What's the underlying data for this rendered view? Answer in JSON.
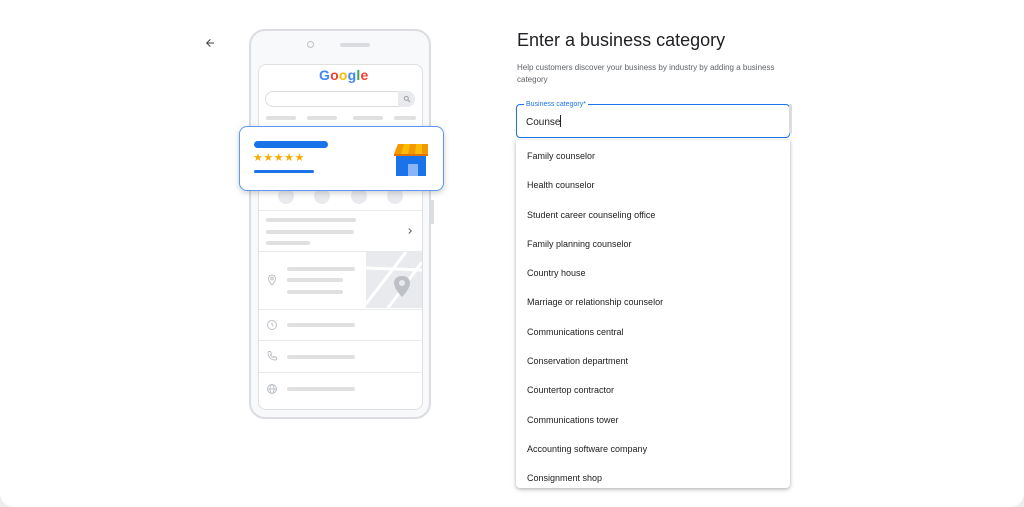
{
  "nav": {
    "back_icon": "arrow-back-icon"
  },
  "illustration": {
    "logo": {
      "G": "G",
      "o1": "o",
      "o2": "o",
      "g": "g",
      "l": "l",
      "e": "e"
    },
    "rating_stars": 5,
    "colors": {
      "brand_blue": "#1a73e8",
      "star": "#f9ab00",
      "store_awning": "#fbbc05"
    }
  },
  "form": {
    "title": "Enter a business category",
    "help_text": "Help customers discover your business by industry by adding a business category",
    "field_label": "Business category*",
    "field_value": "Counse",
    "accent_color": "#1a73e8"
  },
  "suggestions": [
    "Family counselor",
    "Health counselor",
    "Student career counseling office",
    "Family planning counselor",
    "Country house",
    "Marriage or relationship counselor",
    "Communications central",
    "Conservation department",
    "Countertop contractor",
    "Communications tower",
    "Accounting software company",
    "Consignment shop"
  ]
}
